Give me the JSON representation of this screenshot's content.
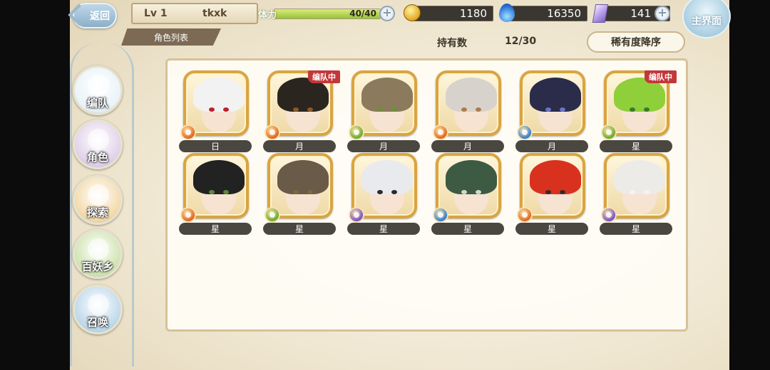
{
  "topbar": {
    "back_label": "返回",
    "level": "Lv 1",
    "player_name": "tkxk",
    "stamina_label": "体力",
    "stamina_value": "40/40",
    "stamina_fraction": 1.0,
    "gold": "1180",
    "soul": "16350",
    "gem": "141",
    "main_label": "主界面",
    "tab_title": "角色列表"
  },
  "header": {
    "hold_label": "持有数",
    "hold_count": "12/30",
    "sort_label": "稀有度降序"
  },
  "side_menu": [
    {
      "label": "编队",
      "icon": "team-icon",
      "color": "#e9f3f7"
    },
    {
      "label": "角色",
      "icon": "character-icon",
      "color": "#e0d0e8"
    },
    {
      "label": "探索",
      "icon": "explore-icon",
      "color": "#f3d9a8"
    },
    {
      "label": "百妖乡",
      "icon": "village-icon",
      "color": "#cfe3b0"
    },
    {
      "label": "召唤",
      "icon": "summon-icon",
      "color": "#bcd7ea"
    }
  ],
  "characters": [
    {
      "label": "日",
      "element": "fire",
      "element_color": "#e0641c",
      "hair": "#f2f2f2",
      "eyes": "#c11f2a",
      "in_team": false,
      "badge": ""
    },
    {
      "label": "月",
      "element": "fire",
      "element_color": "#e0641c",
      "hair": "#2b2520",
      "eyes": "#8a5a2a",
      "in_team": true,
      "badge": "编队中"
    },
    {
      "label": "月",
      "element": "wind",
      "element_color": "#6aa82a",
      "hair": "#8b7a5c",
      "eyes": "#6b8f3a",
      "in_team": false,
      "badge": ""
    },
    {
      "label": "月",
      "element": "fire",
      "element_color": "#e0641c",
      "hair": "#d7d3cc",
      "eyes": "#b07a4a",
      "in_team": false,
      "badge": ""
    },
    {
      "label": "月",
      "element": "water",
      "element_color": "#2f7dd1",
      "hair": "#2a2c4a",
      "eyes": "#6c74c4",
      "in_team": false,
      "badge": ""
    },
    {
      "label": "星",
      "element": "wind",
      "element_color": "#6aa82a",
      "hair": "#8fcf3a",
      "eyes": "#3a7a2a",
      "in_team": true,
      "badge": "编队中"
    },
    {
      "label": "星",
      "element": "fire",
      "element_color": "#e0641c",
      "hair": "#222222",
      "eyes": "#5a8a3a",
      "in_team": false,
      "badge": ""
    },
    {
      "label": "星",
      "element": "wind",
      "element_color": "#6aa82a",
      "hair": "#6a5a48",
      "eyes": "#7a6a3a",
      "in_team": false,
      "badge": ""
    },
    {
      "label": "星",
      "element": "dark",
      "element_color": "#7a4cc4",
      "hair": "#e9eaee",
      "eyes": "#2a2a2a",
      "in_team": false,
      "badge": ""
    },
    {
      "label": "星",
      "element": "water",
      "element_color": "#2f7dd1",
      "hair": "#3d5a42",
      "eyes": "#cfd8d0",
      "in_team": false,
      "badge": ""
    },
    {
      "label": "星",
      "element": "fire",
      "element_color": "#e0641c",
      "hair": "#d8321f",
      "eyes": "#3a2a2a",
      "in_team": false,
      "badge": ""
    },
    {
      "label": "星",
      "element": "dark",
      "element_color": "#7a4cc4",
      "hair": "#ecebe8",
      "eyes": "#f4f4f4",
      "in_team": false,
      "badge": ""
    }
  ],
  "colors": {
    "accent_gold": "#d9a441",
    "badge_red": "#c3373a",
    "tag_dark": "#4a4740",
    "panel_border": "#d7c298"
  }
}
